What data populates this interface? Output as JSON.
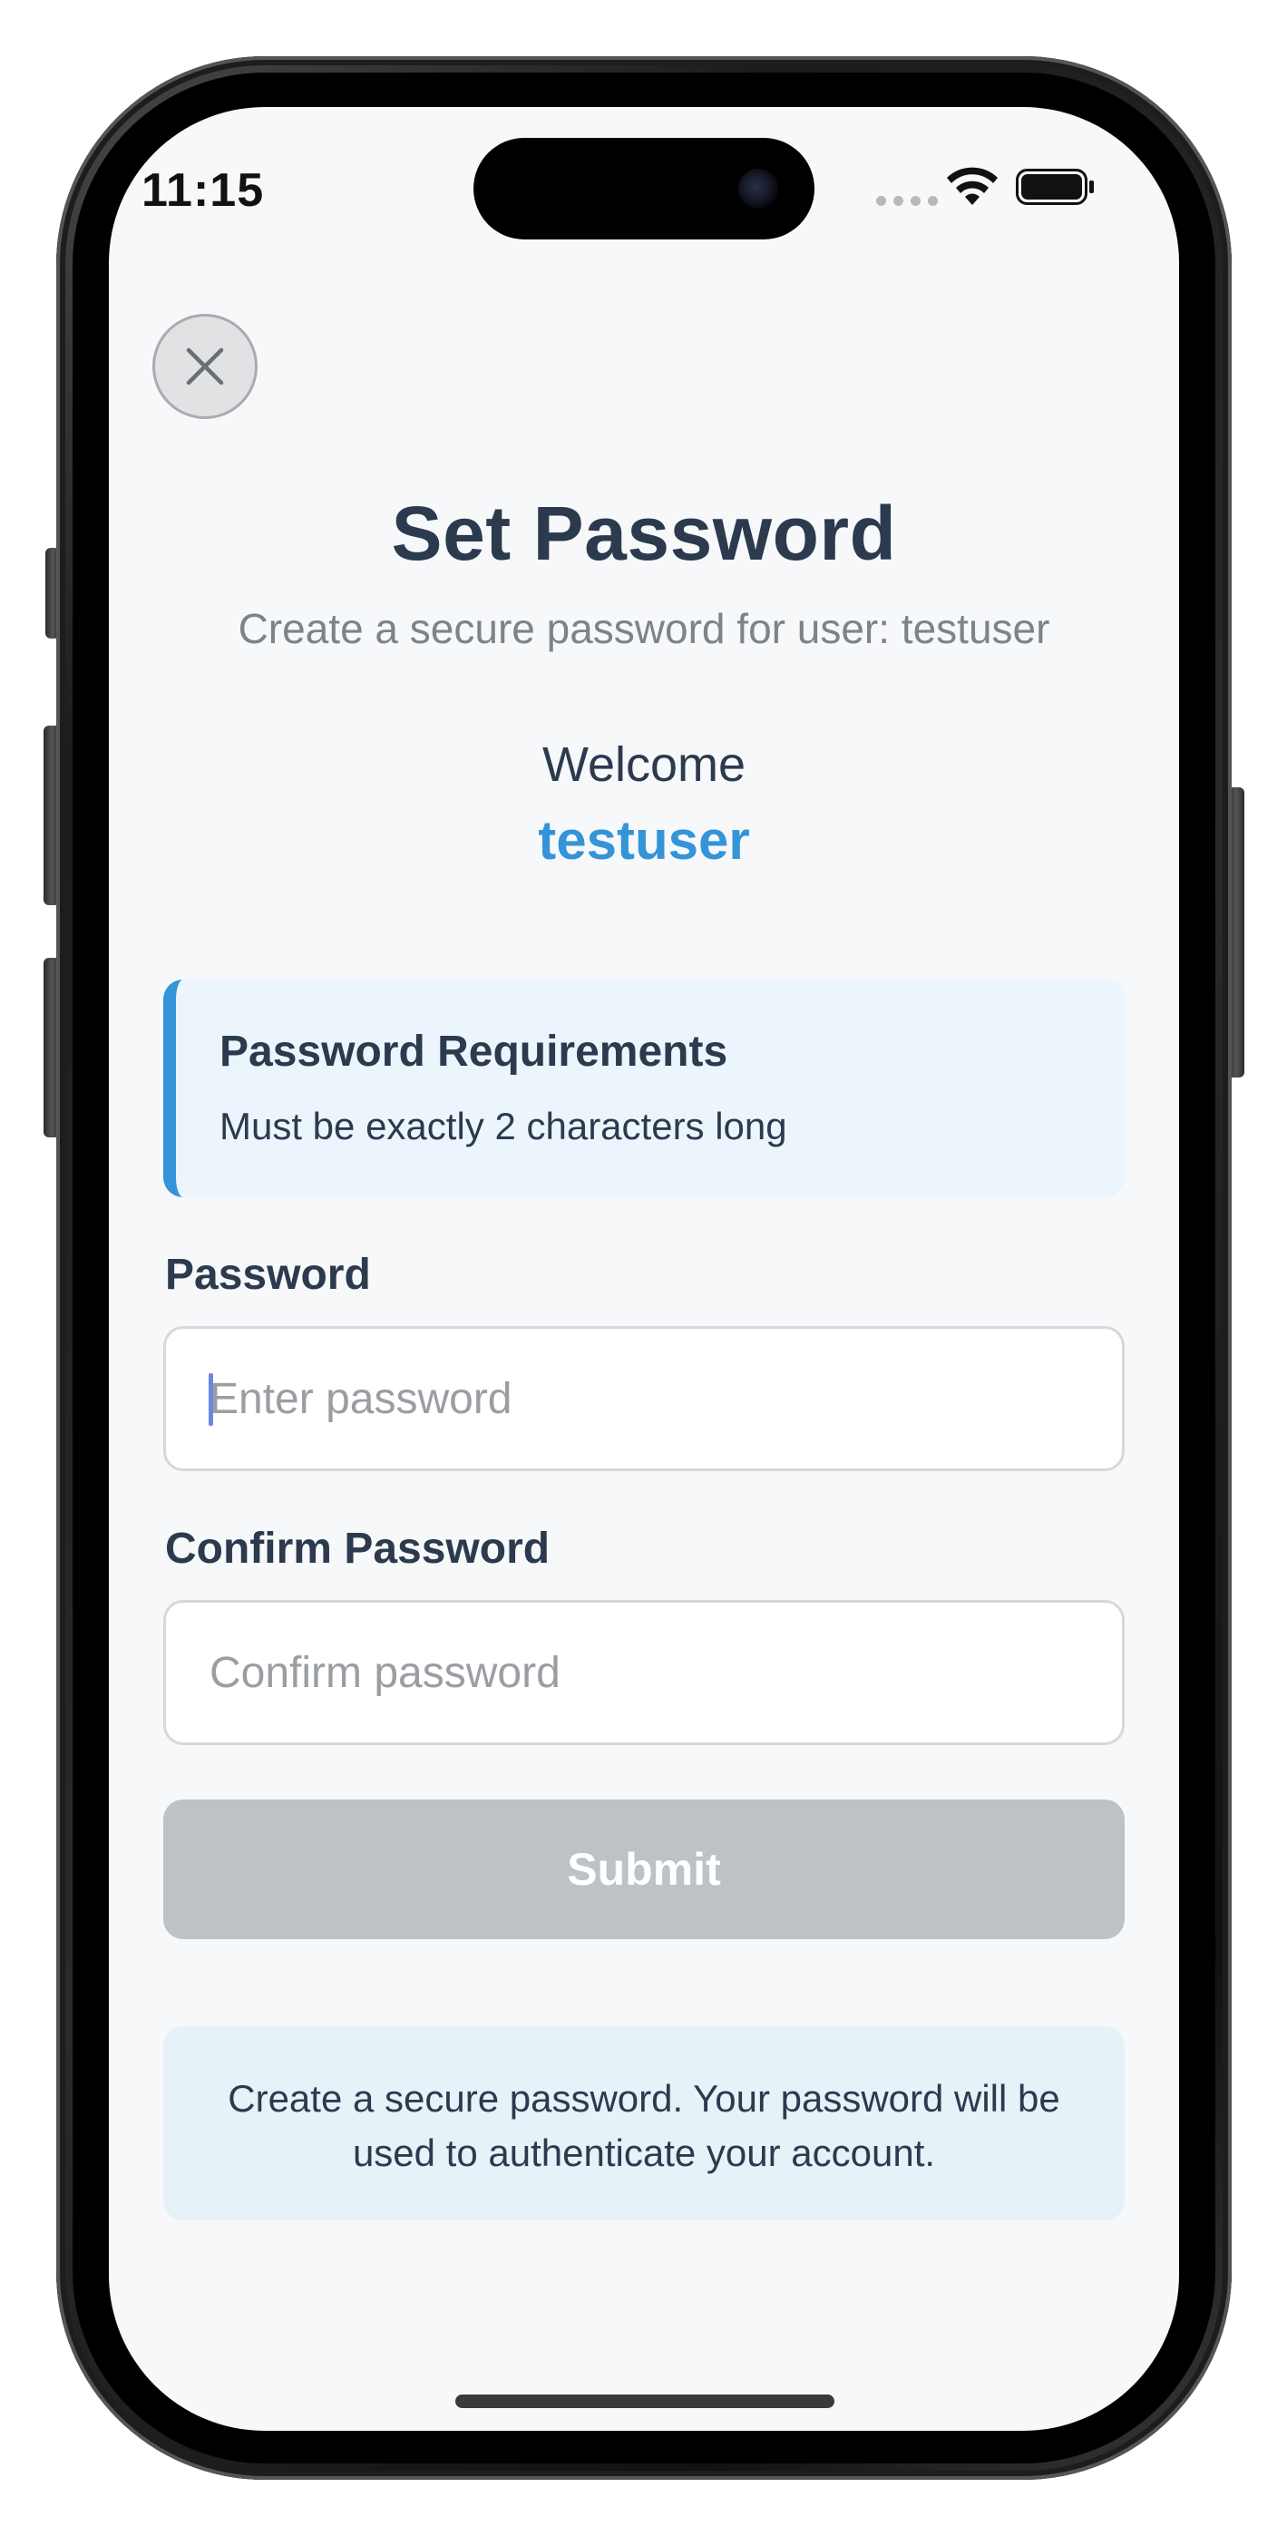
{
  "status_bar": {
    "time": "11:15"
  },
  "header": {
    "close_icon": "x-close-icon",
    "title": "Set Password",
    "subtitle": "Create a secure password for user: testuser"
  },
  "welcome": {
    "label": "Welcome",
    "username": "testuser"
  },
  "requirements": {
    "title": "Password Requirements",
    "text": "Must be exactly 2 characters long"
  },
  "form": {
    "password_label": "Password",
    "password_value": "",
    "password_placeholder": "Enter password",
    "confirm_label": "Confirm Password",
    "confirm_value": "",
    "confirm_placeholder": "Confirm password",
    "submit_label": "Submit"
  },
  "info": {
    "text": "Create a secure password. Your password will be used to authenticate your account."
  },
  "colors": {
    "accent": "#3594d8",
    "text_primary": "#2c3a4e",
    "text_secondary": "#7d8388",
    "submit_disabled": "#bdc2c6",
    "requirements_bg": "#edf5fc",
    "info_bg": "#e6f2f8"
  }
}
